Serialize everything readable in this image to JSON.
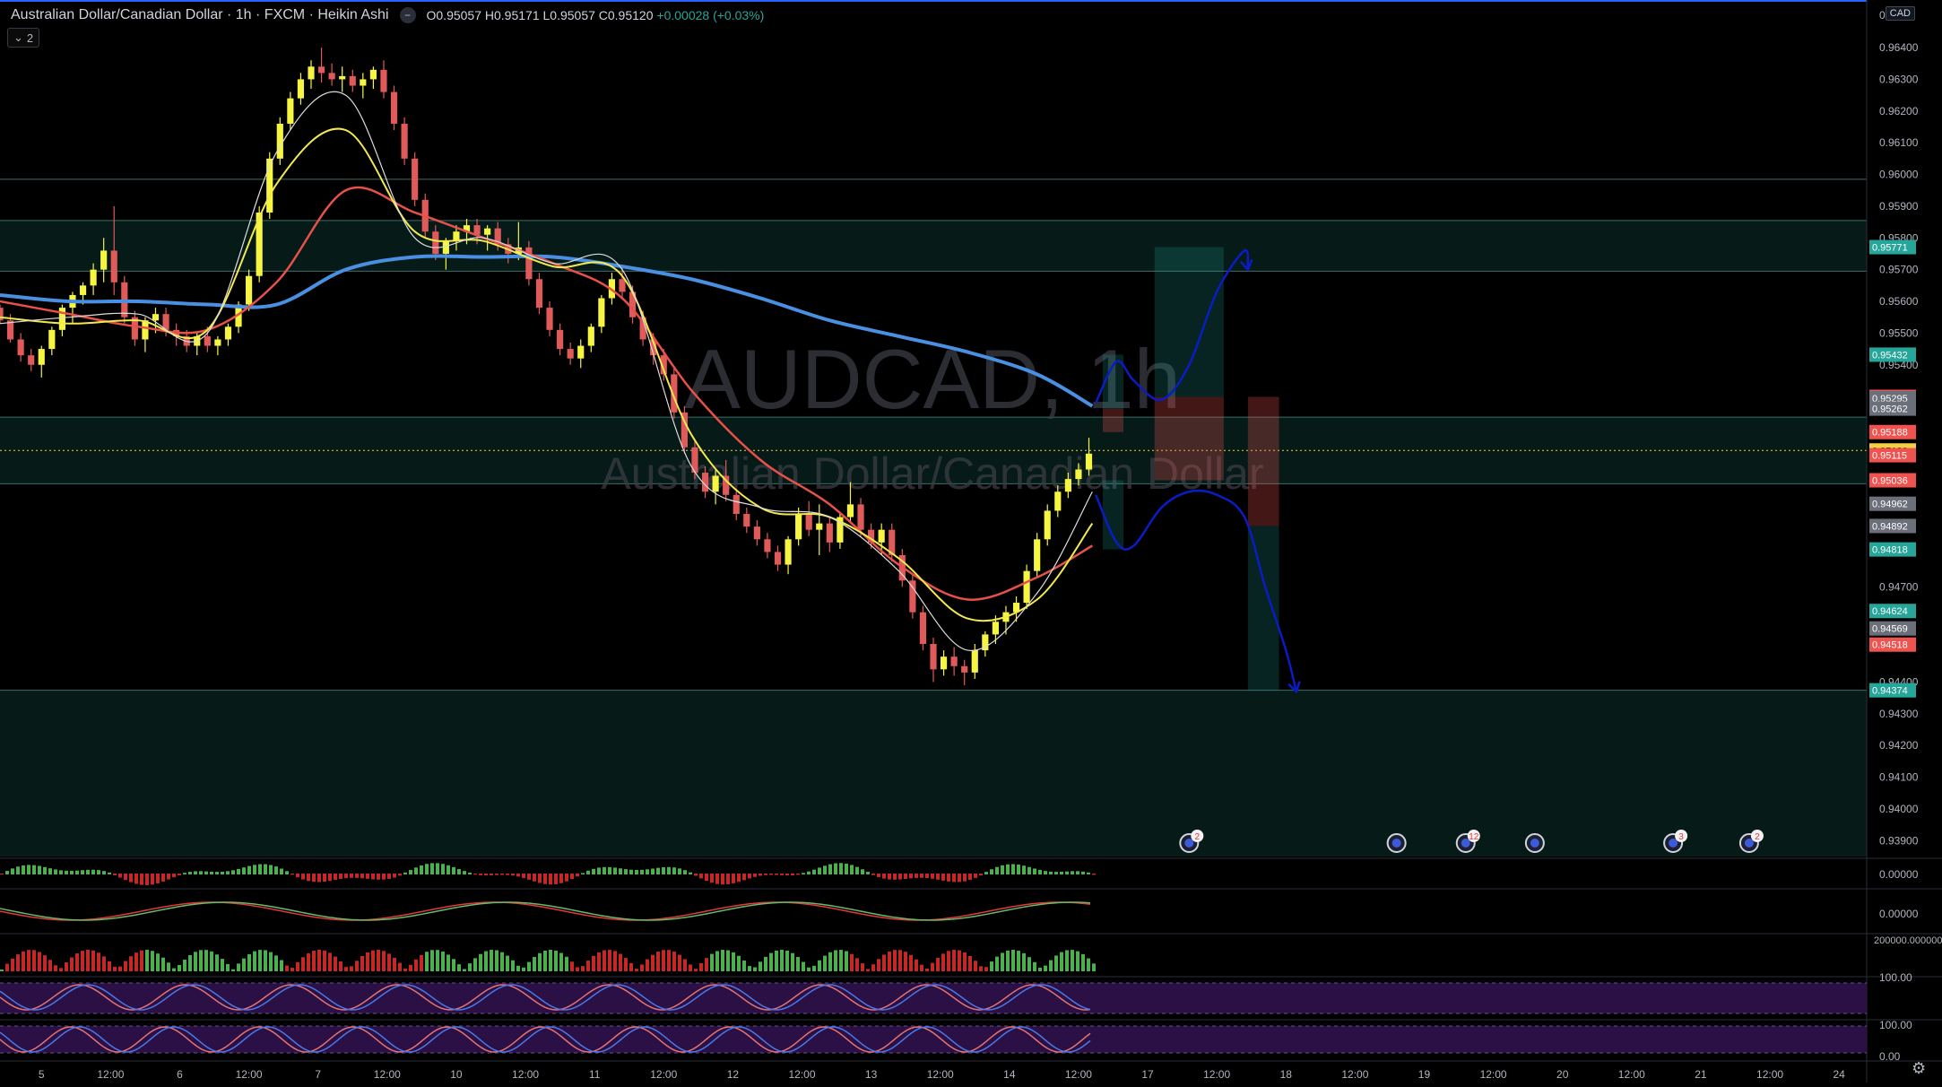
{
  "header": {
    "symbol_title": "Australian Dollar/Canadian Dollar",
    "interval": "1h",
    "exchange": "FXCM",
    "chart_style": "Heikin Ashi",
    "collapse_icon": "minus-icon",
    "ohlc": "O0.95057 H0.95171 L0.95057 C0.95120",
    "change": "+0.00028 (+0.03%)"
  },
  "indicator_toggle": {
    "icon": "chevron-down-icon",
    "count": "2"
  },
  "currency_badge": "CAD",
  "settings_icon": "gear-icon",
  "watermark": {
    "symbol": "AUDCAD, 1h",
    "description": "Australian Dollar/Canadian Dollar"
  },
  "colors": {
    "background": "#000000",
    "zone_fill": "#061a18",
    "bull_candle": "#f5f542",
    "bear_candle": "#e05a5a",
    "ema_blue": "#4a90e2",
    "ema_red": "#e8504a",
    "ema_yellow": "#f2e94e",
    "ema_white": "#dddddd",
    "projection": "#0a1cc4",
    "teal_label": "#26a69a",
    "red_label": "#ef5350",
    "grey_label": "#6b6f7a",
    "current_price": "#f5d142",
    "oscillator_band": "#2a1045"
  },
  "chart_data": {
    "type": "candlestick",
    "title": "Australian Dollar/Canadian Dollar · 1h · FXCM",
    "style": "Heikin Ashi",
    "grid": false,
    "ylim": [
      0.9385,
      0.9655
    ],
    "y_ticks": [
      "0.96400",
      "0.96300",
      "0.96200",
      "0.96100",
      "0.96000",
      "0.95900",
      "0.95800",
      "0.95700",
      "0.95600",
      "0.95500",
      "0.95400",
      "0.94700",
      "0.94400",
      "0.94300",
      "0.94200",
      "0.94100",
      "0.94000",
      "0.93900"
    ],
    "y_tick_values": [
      0.964,
      0.963,
      0.962,
      0.961,
      0.96,
      0.959,
      0.958,
      0.957,
      0.956,
      0.955,
      0.954,
      0.947,
      0.944,
      0.943,
      0.942,
      0.941,
      0.94,
      0.939
    ],
    "y_top_partial_label": "0.96",
    "x_ticks": [
      "5",
      "12:00",
      "6",
      "12:00",
      "7",
      "12:00",
      "10",
      "12:00",
      "11",
      "12:00",
      "12",
      "12:00",
      "13",
      "12:00",
      "14",
      "12:00",
      "17",
      "12:00",
      "18",
      "12:00",
      "19",
      "12:00",
      "20",
      "12:00",
      "21",
      "12:00",
      "24"
    ],
    "x_domain": [
      0,
      27
    ],
    "price_labels": [
      {
        "text": "0.95771",
        "value": 0.95771,
        "color": "teal"
      },
      {
        "text": "0.95432",
        "value": 0.95432,
        "color": "teal"
      },
      {
        "text": "0.95299",
        "value": 0.95299,
        "color": "red"
      },
      {
        "text": "0.95295",
        "value": 0.95295,
        "color": "grey"
      },
      {
        "text": "0.95262",
        "value": 0.95262,
        "color": "grey"
      },
      {
        "text": "0.95188",
        "value": 0.95188,
        "color": "red"
      },
      {
        "text": "0.95130",
        "value": 0.9513,
        "color": "yellow"
      },
      {
        "text": "0.95115",
        "value": 0.95115,
        "color": "red"
      },
      {
        "text": "0.95036",
        "value": 0.95036,
        "color": "red"
      },
      {
        "text": "0.94962",
        "value": 0.94962,
        "color": "grey"
      },
      {
        "text": "0.94892",
        "value": 0.94892,
        "color": "grey"
      },
      {
        "text": "0.94818",
        "value": 0.94818,
        "color": "teal"
      },
      {
        "text": "0.94624",
        "value": 0.94624,
        "color": "teal"
      },
      {
        "text": "0.94569",
        "value": 0.94569,
        "color": "grey"
      },
      {
        "text": "0.94518",
        "value": 0.94518,
        "color": "red"
      },
      {
        "text": "0.94374",
        "value": 0.94374,
        "color": "teal"
      }
    ],
    "horizontal_levels": [
      0.95985,
      0.95855,
      0.95695,
      0.95235,
      0.95025,
      0.94374
    ],
    "zones": [
      [
        0.95695,
        0.95855
      ],
      [
        0.95025,
        0.95235
      ],
      [
        0.9385,
        0.94374
      ]
    ],
    "current_price": 0.9513,
    "series": [
      {
        "name": "EMA 200",
        "color": "blue",
        "x": [
          0,
          1,
          2,
          3,
          4,
          5,
          6,
          7,
          8,
          9,
          10,
          11,
          12,
          13,
          14,
          15,
          15.8
        ],
        "y": [
          0.9562,
          0.956,
          0.956,
          0.9559,
          0.9559,
          0.957,
          0.9574,
          0.9574,
          0.9574,
          0.9571,
          0.9567,
          0.9561,
          0.9554,
          0.9549,
          0.9544,
          0.9537,
          0.9527
        ]
      },
      {
        "name": "EMA 50",
        "color": "red",
        "x": [
          0,
          1,
          2,
          3,
          4,
          5,
          6,
          7,
          8,
          9,
          10,
          11,
          12,
          13,
          14,
          15,
          15.8
        ],
        "y": [
          0.956,
          0.9556,
          0.9552,
          0.9551,
          0.9566,
          0.9595,
          0.9588,
          0.958,
          0.9572,
          0.9561,
          0.9532,
          0.951,
          0.9496,
          0.9477,
          0.9466,
          0.9473,
          0.9483
        ]
      },
      {
        "name": "EMA 20",
        "color": "yellow",
        "x": [
          0,
          1,
          2,
          3,
          4,
          5,
          6,
          7,
          8,
          9,
          10,
          11,
          12,
          13,
          14,
          15,
          15.8
        ],
        "y": [
          0.9555,
          0.9553,
          0.9554,
          0.9551,
          0.9597,
          0.9614,
          0.9582,
          0.9579,
          0.9571,
          0.9568,
          0.9518,
          0.9495,
          0.9492,
          0.9479,
          0.946,
          0.9466,
          0.949
        ]
      },
      {
        "name": "EMA 9",
        "color": "white",
        "x": [
          0,
          1,
          2,
          3,
          4,
          5,
          6,
          7,
          8,
          9,
          10,
          11,
          12,
          13,
          14,
          15,
          15.8
        ],
        "y": [
          0.9553,
          0.9555,
          0.9556,
          0.955,
          0.9607,
          0.9625,
          0.958,
          0.958,
          0.9572,
          0.957,
          0.9508,
          0.9495,
          0.9492,
          0.9475,
          0.945,
          0.9468,
          0.95
        ]
      }
    ],
    "candles": [
      [
        0.0,
        0.9558,
        0.9559,
        0.9553,
        0.9554
      ],
      [
        0.15,
        0.9554,
        0.9556,
        0.9547,
        0.9548
      ],
      [
        0.3,
        0.9548,
        0.955,
        0.9541,
        0.9543
      ],
      [
        0.45,
        0.9543,
        0.9545,
        0.9538,
        0.954
      ],
      [
        0.6,
        0.954,
        0.9546,
        0.9536,
        0.9545
      ],
      [
        0.75,
        0.9545,
        0.9552,
        0.9543,
        0.9551
      ],
      [
        0.9,
        0.9551,
        0.9559,
        0.9549,
        0.9558
      ],
      [
        1.05,
        0.9558,
        0.9563,
        0.9553,
        0.9562
      ],
      [
        1.2,
        0.9562,
        0.9566,
        0.9559,
        0.9565
      ],
      [
        1.35,
        0.9565,
        0.9572,
        0.9562,
        0.957
      ],
      [
        1.5,
        0.957,
        0.958,
        0.9566,
        0.9576
      ],
      [
        1.65,
        0.9576,
        0.959,
        0.9562,
        0.9566
      ],
      [
        1.8,
        0.9566,
        0.9568,
        0.9553,
        0.9555
      ],
      [
        1.95,
        0.9555,
        0.9557,
        0.9546,
        0.9548
      ],
      [
        2.1,
        0.9548,
        0.9555,
        0.9544,
        0.9554
      ],
      [
        2.25,
        0.9554,
        0.9558,
        0.955,
        0.9556
      ],
      [
        2.4,
        0.9556,
        0.9558,
        0.9549,
        0.9551
      ],
      [
        2.55,
        0.9551,
        0.9553,
        0.9546,
        0.9549
      ],
      [
        2.7,
        0.9549,
        0.9551,
        0.9544,
        0.9546
      ],
      [
        2.85,
        0.9546,
        0.955,
        0.9543,
        0.9549
      ],
      [
        3.0,
        0.9549,
        0.9552,
        0.9544,
        0.9546
      ],
      [
        3.15,
        0.9546,
        0.9549,
        0.9543,
        0.9548
      ],
      [
        3.3,
        0.9548,
        0.9553,
        0.9546,
        0.9552
      ],
      [
        3.45,
        0.9552,
        0.956,
        0.955,
        0.9559
      ],
      [
        3.6,
        0.9559,
        0.957,
        0.9557,
        0.9568
      ],
      [
        3.75,
        0.9568,
        0.959,
        0.9566,
        0.9588
      ],
      [
        3.9,
        0.9588,
        0.9607,
        0.9586,
        0.9605
      ],
      [
        4.05,
        0.9605,
        0.9618,
        0.9603,
        0.9616
      ],
      [
        4.2,
        0.9616,
        0.9626,
        0.9614,
        0.9624
      ],
      [
        4.35,
        0.9624,
        0.9632,
        0.9622,
        0.963
      ],
      [
        4.5,
        0.963,
        0.9636,
        0.9627,
        0.9634
      ],
      [
        4.65,
        0.9634,
        0.964,
        0.9629,
        0.9632
      ],
      [
        4.8,
        0.9632,
        0.9635,
        0.9628,
        0.963
      ],
      [
        4.95,
        0.963,
        0.9634,
        0.9626,
        0.9631
      ],
      [
        5.1,
        0.9631,
        0.9633,
        0.9626,
        0.9628
      ],
      [
        5.25,
        0.9628,
        0.9632,
        0.9624,
        0.963
      ],
      [
        5.4,
        0.963,
        0.9634,
        0.9627,
        0.9633
      ],
      [
        5.55,
        0.9633,
        0.9636,
        0.9624,
        0.9626
      ],
      [
        5.7,
        0.9626,
        0.9628,
        0.9614,
        0.9616
      ],
      [
        5.85,
        0.9616,
        0.9618,
        0.9603,
        0.9605
      ],
      [
        6.0,
        0.9605,
        0.9607,
        0.959,
        0.9592
      ],
      [
        6.15,
        0.9592,
        0.9594,
        0.958,
        0.9582
      ],
      [
        6.3,
        0.9582,
        0.9584,
        0.9573,
        0.9575
      ],
      [
        6.45,
        0.9575,
        0.958,
        0.957,
        0.9579
      ],
      [
        6.6,
        0.9579,
        0.9584,
        0.9576,
        0.9582
      ],
      [
        6.75,
        0.9582,
        0.9586,
        0.9578,
        0.9584
      ],
      [
        6.9,
        0.9584,
        0.9586,
        0.9578,
        0.9581
      ],
      [
        7.05,
        0.9581,
        0.9584,
        0.9576,
        0.9583
      ],
      [
        7.2,
        0.9583,
        0.9585,
        0.9576,
        0.9578
      ],
      [
        7.35,
        0.9578,
        0.958,
        0.9572,
        0.9575
      ],
      [
        7.5,
        0.9575,
        0.9585,
        0.9573,
        0.9577
      ],
      [
        7.65,
        0.9577,
        0.9579,
        0.9565,
        0.9567
      ],
      [
        7.8,
        0.9567,
        0.9569,
        0.9556,
        0.9558
      ],
      [
        7.95,
        0.9558,
        0.956,
        0.9549,
        0.9551
      ],
      [
        8.1,
        0.9551,
        0.9553,
        0.9543,
        0.9545
      ],
      [
        8.25,
        0.9545,
        0.9547,
        0.954,
        0.9542
      ],
      [
        8.4,
        0.9542,
        0.9548,
        0.9539,
        0.9546
      ],
      [
        8.55,
        0.9546,
        0.9553,
        0.9544,
        0.9552
      ],
      [
        8.7,
        0.9552,
        0.9562,
        0.955,
        0.9561
      ],
      [
        8.85,
        0.9561,
        0.9569,
        0.9559,
        0.9567
      ],
      [
        9.0,
        0.9567,
        0.9571,
        0.9561,
        0.9563
      ],
      [
        9.15,
        0.9563,
        0.9565,
        0.9553,
        0.9555
      ],
      [
        9.3,
        0.9555,
        0.9557,
        0.9546,
        0.9548
      ],
      [
        9.45,
        0.9548,
        0.955,
        0.954,
        0.9543
      ],
      [
        9.6,
        0.9543,
        0.9545,
        0.9535,
        0.9537
      ],
      [
        9.75,
        0.9537,
        0.9539,
        0.9523,
        0.9525
      ],
      [
        9.9,
        0.9525,
        0.9527,
        0.9512,
        0.9514
      ],
      [
        10.05,
        0.9514,
        0.9516,
        0.9504,
        0.9506
      ],
      [
        10.2,
        0.9506,
        0.9508,
        0.9498,
        0.95
      ],
      [
        10.35,
        0.95,
        0.9507,
        0.9496,
        0.9505
      ],
      [
        10.5,
        0.9505,
        0.951,
        0.9497,
        0.9499
      ],
      [
        10.65,
        0.9499,
        0.9501,
        0.9491,
        0.9493
      ],
      [
        10.8,
        0.9493,
        0.9495,
        0.9487,
        0.9489
      ],
      [
        10.95,
        0.9489,
        0.9491,
        0.9483,
        0.9485
      ],
      [
        11.1,
        0.9485,
        0.9487,
        0.9479,
        0.9481
      ],
      [
        11.25,
        0.9481,
        0.9483,
        0.9475,
        0.9477
      ],
      [
        11.4,
        0.9477,
        0.9486,
        0.9474,
        0.9485
      ],
      [
        11.55,
        0.9485,
        0.9495,
        0.9483,
        0.9493
      ],
      [
        11.7,
        0.9493,
        0.9497,
        0.9486,
        0.9488
      ],
      [
        11.85,
        0.9488,
        0.9496,
        0.948,
        0.949
      ],
      [
        12.0,
        0.949,
        0.9492,
        0.9481,
        0.9484
      ],
      [
        12.15,
        0.9484,
        0.9493,
        0.9482,
        0.9492
      ],
      [
        12.3,
        0.9492,
        0.9503,
        0.949,
        0.9496
      ],
      [
        12.45,
        0.9496,
        0.9498,
        0.9486,
        0.9488
      ],
      [
        12.6,
        0.9488,
        0.949,
        0.9482,
        0.9484
      ],
      [
        12.75,
        0.9484,
        0.949,
        0.948,
        0.9488
      ],
      [
        12.9,
        0.9488,
        0.949,
        0.9478,
        0.948
      ],
      [
        13.05,
        0.948,
        0.9482,
        0.947,
        0.9472
      ],
      [
        13.2,
        0.9472,
        0.9474,
        0.946,
        0.9462
      ],
      [
        13.35,
        0.9462,
        0.9464,
        0.945,
        0.9452
      ],
      [
        13.5,
        0.9452,
        0.9454,
        0.944,
        0.9444
      ],
      [
        13.65,
        0.9444,
        0.945,
        0.9442,
        0.9448
      ],
      [
        13.8,
        0.9448,
        0.9451,
        0.9442,
        0.9445
      ],
      [
        13.95,
        0.9445,
        0.9447,
        0.9439,
        0.9443
      ],
      [
        14.1,
        0.9443,
        0.9452,
        0.9441,
        0.945
      ],
      [
        14.25,
        0.945,
        0.9456,
        0.9448,
        0.9455
      ],
      [
        14.4,
        0.9455,
        0.9461,
        0.9452,
        0.9459
      ],
      [
        14.55,
        0.9459,
        0.9464,
        0.9455,
        0.9462
      ],
      [
        14.7,
        0.9462,
        0.9467,
        0.9459,
        0.9465
      ],
      [
        14.85,
        0.9465,
        0.9477,
        0.9463,
        0.9475
      ],
      [
        15.0,
        0.9475,
        0.9487,
        0.9473,
        0.9485
      ],
      [
        15.15,
        0.9485,
        0.9496,
        0.9483,
        0.9494
      ],
      [
        15.3,
        0.9494,
        0.9502,
        0.9492,
        0.95
      ],
      [
        15.45,
        0.95,
        0.9506,
        0.9498,
        0.9504
      ],
      [
        15.6,
        0.9504,
        0.9509,
        0.9502,
        0.9507
      ],
      [
        15.75,
        0.9507,
        0.9517,
        0.9505,
        0.9512
      ]
    ],
    "projection_path": [
      [
        15.85,
        0.9528
      ],
      [
        16.15,
        0.9541
      ],
      [
        16.4,
        0.9535
      ],
      [
        16.8,
        0.9529
      ],
      [
        17.2,
        0.954
      ],
      [
        17.6,
        0.9563
      ],
      [
        18.0,
        0.9576
      ],
      [
        18.05,
        0.957
      ]
    ],
    "projection_path_2": [
      [
        15.85,
        0.9499
      ],
      [
        16.15,
        0.9484
      ],
      [
        16.4,
        0.9483
      ],
      [
        16.8,
        0.9495
      ],
      [
        17.2,
        0.95
      ],
      [
        17.6,
        0.9499
      ],
      [
        18.0,
        0.9492
      ],
      [
        18.3,
        0.947
      ],
      [
        18.6,
        0.945
      ],
      [
        18.75,
        0.9437
      ]
    ],
    "position_boxes": [
      {
        "x0": 15.95,
        "x1": 16.25,
        "y0": 0.95262,
        "y1": 0.95432,
        "kind": "profit"
      },
      {
        "x0": 15.95,
        "x1": 16.25,
        "y0": 0.95188,
        "y1": 0.95262,
        "kind": "loss"
      },
      {
        "x0": 15.95,
        "x1": 16.25,
        "y0": 0.94818,
        "y1": 0.95036,
        "kind": "profit"
      },
      {
        "x0": 16.7,
        "x1": 17.7,
        "y0": 0.95299,
        "y1": 0.95771,
        "kind": "profit"
      },
      {
        "x0": 16.7,
        "x1": 17.7,
        "y0": 0.95036,
        "y1": 0.95299,
        "kind": "loss"
      },
      {
        "x0": 18.05,
        "x1": 18.5,
        "y0": 0.94892,
        "y1": 0.95299,
        "kind": "loss"
      },
      {
        "x0": 18.05,
        "x1": 18.5,
        "y0": 0.94374,
        "y1": 0.94892,
        "kind": "profit"
      }
    ],
    "event_markers_x": [
      17.2,
      20.2,
      21.2,
      22.2,
      24.2,
      25.3
    ],
    "event_badges": [
      "2",
      "",
      "12",
      "",
      "3",
      "2"
    ]
  },
  "sub_panes": [
    {
      "name": "pane-1",
      "label": "0.00000"
    },
    {
      "name": "pane-2",
      "label": "0.00000"
    },
    {
      "name": "pane-3",
      "label": "200000.000000"
    },
    {
      "name": "pane-4",
      "label": "100.00"
    },
    {
      "name": "pane-5",
      "labels": [
        "100.00",
        "0.00"
      ]
    }
  ]
}
